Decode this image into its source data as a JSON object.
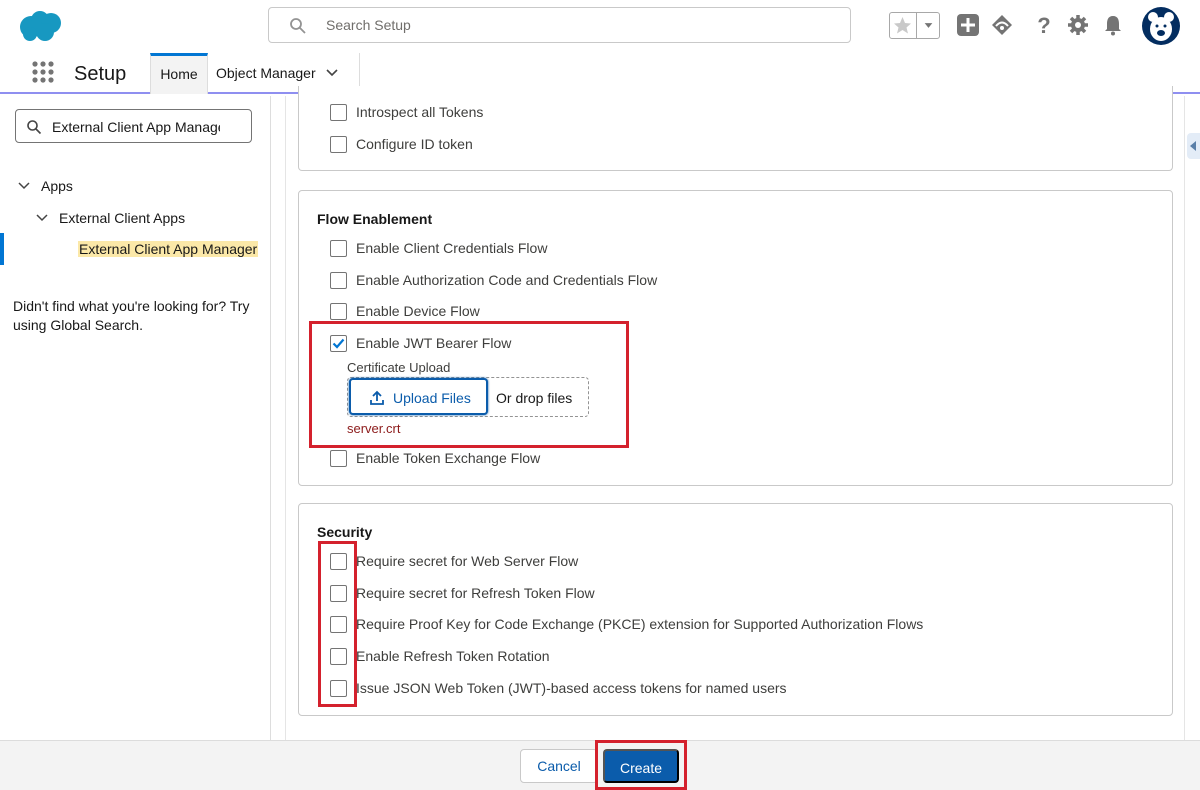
{
  "header": {
    "search_placeholder": "Search Setup",
    "app_title": "Setup",
    "tabs": [
      {
        "label": "Home"
      },
      {
        "label": "Object Manager"
      }
    ]
  },
  "sidebar": {
    "quick_find_value": "External Client App Manager",
    "tree": [
      {
        "label": "Apps"
      },
      {
        "label": "External Client Apps"
      },
      {
        "label": "External Client App Manager"
      }
    ],
    "help_text": "Didn't find what you're looking for? Try using Global Search."
  },
  "oauth_card": {
    "options": [
      {
        "label": "Introspect all Tokens",
        "checked": false
      },
      {
        "label": "Configure ID token",
        "checked": false
      }
    ]
  },
  "flow_card": {
    "title": "Flow Enablement",
    "options": [
      {
        "label": "Enable Client Credentials Flow",
        "checked": false
      },
      {
        "label": "Enable Authorization Code and Credentials Flow",
        "checked": false
      },
      {
        "label": "Enable Device Flow",
        "checked": false
      },
      {
        "label": "Enable JWT Bearer Flow",
        "checked": true
      },
      {
        "label": "Enable Token Exchange Flow",
        "checked": false
      }
    ],
    "certificate_label": "Certificate Upload",
    "upload_button": "Upload Files",
    "drop_text": "Or drop files",
    "uploaded_file": "server.crt"
  },
  "security_card": {
    "title": "Security",
    "options": [
      {
        "label": "Require secret for Web Server Flow",
        "checked": false
      },
      {
        "label": "Require secret for Refresh Token Flow",
        "checked": false
      },
      {
        "label": "Require Proof Key for Code Exchange (PKCE) extension for Supported Authorization Flows",
        "checked": false
      },
      {
        "label": "Enable Refresh Token Rotation",
        "checked": false
      },
      {
        "label": "Issue JSON Web Token (JWT)-based access tokens for named users",
        "checked": false
      }
    ]
  },
  "footer": {
    "cancel_label": "Cancel",
    "create_label": "Create"
  },
  "colors": {
    "brand_blue": "#0b5cab",
    "highlight_red": "#d4212d",
    "selected_tree_bg": "#fbe8a8"
  }
}
